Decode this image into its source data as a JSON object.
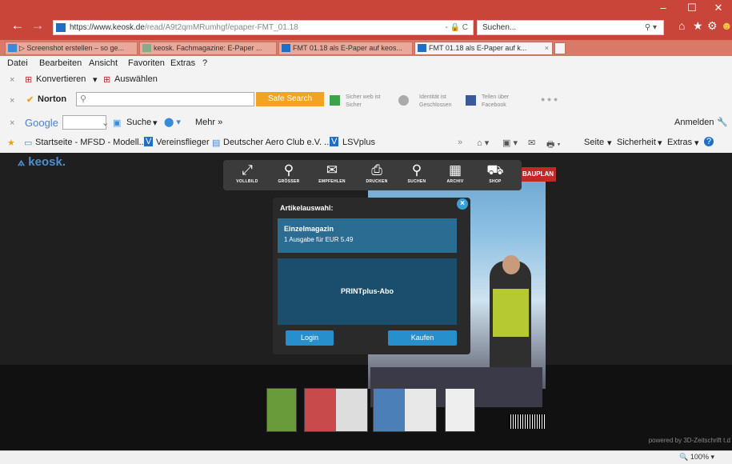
{
  "browser": {
    "address": {
      "scheme": "https://",
      "host": "www.keosk.de",
      "path": "/read/A9t2qmMRumhgf/epaper-FMT_01.18",
      "tools": "- 🔒 C"
    },
    "search_placeholder": "Suchen...",
    "tabs": [
      {
        "label": "▷ Screenshot erstellen – so ge...",
        "active": false
      },
      {
        "label": "keosk. Fachmagazine: E-Paper ...",
        "active": false
      },
      {
        "label": "FMT 01.18 als E-Paper auf keos...",
        "active": false
      },
      {
        "label": "FMT 01.18 als E-Paper auf k...",
        "active": true
      }
    ],
    "menu": [
      "Datei",
      "Bearbeiten",
      "Ansicht",
      "Favoriten",
      "Extras",
      "?"
    ],
    "toolbar1": {
      "convert": "Konvertieren",
      "select": "Auswählen"
    },
    "norton": {
      "brand": "Norton",
      "safe_search": "Safe Search",
      "safe_web": "Sicher",
      "safe_web_small": "Sicher web ist",
      "identity": "Geschlossen",
      "identity_small": "Identität ist",
      "facebook": "Facebook",
      "facebook_small": "Teilen über"
    },
    "google": {
      "brand": "Google",
      "search": "Suche",
      "more": "Mehr »",
      "login": "Anmelden"
    },
    "favorites": [
      "Startseite - MFSD - Modell...",
      "Vereinsflieger",
      "Deutscher Aero Club e.V. ...",
      "LSVplus"
    ],
    "fav_tools": {
      "page": "Seite",
      "security": "Sicherheit",
      "extras": "Extras"
    },
    "zoom": "100%"
  },
  "keosk": {
    "logo": "keosk.",
    "toolbar": [
      {
        "label": "VOLLBILD",
        "icon": "fullscreen-icon",
        "glyph": "⤢"
      },
      {
        "label": "GRÖSSER",
        "icon": "zoom-in-icon",
        "glyph": "🔍"
      },
      {
        "label": "EMPFEHLEN",
        "icon": "mail-icon",
        "glyph": "✉"
      },
      {
        "label": "DRUCKEN",
        "icon": "print-icon",
        "glyph": "🖶"
      },
      {
        "label": "SUCHEN",
        "icon": "search-icon",
        "glyph": "⚲"
      },
      {
        "label": "ARCHIV",
        "icon": "archive-icon",
        "glyph": "▦"
      },
      {
        "label": "SHOP",
        "icon": "cart-icon",
        "glyph": "🛒"
      }
    ],
    "modal": {
      "title": "Artikelauswahl:",
      "single_title": "Einzelmagazin",
      "single_price": "1 Ausgabe für EUR 5.49",
      "abo": "PRINTplus-Abo",
      "login": "Login",
      "buy": "Kaufen"
    },
    "magazine_banner": "BAUPLAN",
    "powered": "powered by 3D-Zeitschrift t.d"
  },
  "colors": {
    "titlebar": "#c9453a",
    "accent_blue": "#2790cc",
    "norton_orange": "#f2a324"
  }
}
